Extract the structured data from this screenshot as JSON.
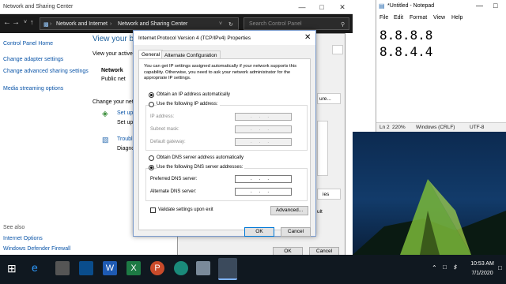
{
  "control_panel": {
    "window_title": "Network and Sharing Center",
    "breadcrumb": [
      "Network and Internet",
      "Network and Sharing Center"
    ],
    "search_placeholder": "Search Control Panel",
    "sidebar": {
      "home": "Control Panel Home",
      "items": [
        "Change adapter settings",
        "Change advanced sharing settings",
        "Media streaming options"
      ],
      "see_also_label": "See also",
      "see_also": [
        "Internet Options",
        "Windows Defender Firewall"
      ]
    },
    "main": {
      "heading": "View your ba",
      "view_active": "View your active",
      "network_label": "Network",
      "network_type": "Public net",
      "change_net": "Change your net",
      "setup_link": "Set up",
      "setup_sub": "Set up",
      "trouble_link": "Troubl",
      "trouble_sub": "Diagno"
    }
  },
  "props_dialog": {
    "ok": "OK",
    "cancel": "Cancel",
    "frag_configure": "ure...",
    "frag_properties": "ies",
    "frag_ult": "ult"
  },
  "tcp_dialog": {
    "title": "Internet Protocol Version 4 (TCP/IPv4) Properties",
    "tabs": [
      "General",
      "Alternate Configuration"
    ],
    "intro": "You can get IP settings assigned automatically if your network supports this capability. Otherwise, you need to ask your network administrator for the appropriate IP settings.",
    "obtain_ip": "Obtain an IP address automatically",
    "use_ip": "Use the following IP address:",
    "ip_address": "IP address:",
    "subnet": "Subnet mask:",
    "gateway": "Default gateway:",
    "obtain_dns": "Obtain DNS server address automatically",
    "use_dns": "Use the following DNS server addresses:",
    "preferred_dns": "Preferred DNS server:",
    "alternate_dns": "Alternate DNS server:",
    "ip_placeholder": "...",
    "validate": "Validate settings upon exit",
    "advanced": "Advanced...",
    "ok": "OK",
    "cancel": "Cancel"
  },
  "notepad": {
    "title": "*Untitled - Notepad",
    "menu": [
      "File",
      "Edit",
      "Format",
      "View",
      "Help"
    ],
    "lines": [
      "8.8.8.8",
      "8.8.4.4"
    ],
    "status": {
      "position": "Ln 2",
      "zoom": "220%",
      "eol": "Windows (CRLF)",
      "encoding": "UTF-8"
    }
  },
  "taskbar": {
    "time": "10:53 AM",
    "date": "7/1/2020"
  },
  "colors": {
    "link": "#0b55a8",
    "taskbar": "#101820",
    "accent": "#0078d7"
  }
}
